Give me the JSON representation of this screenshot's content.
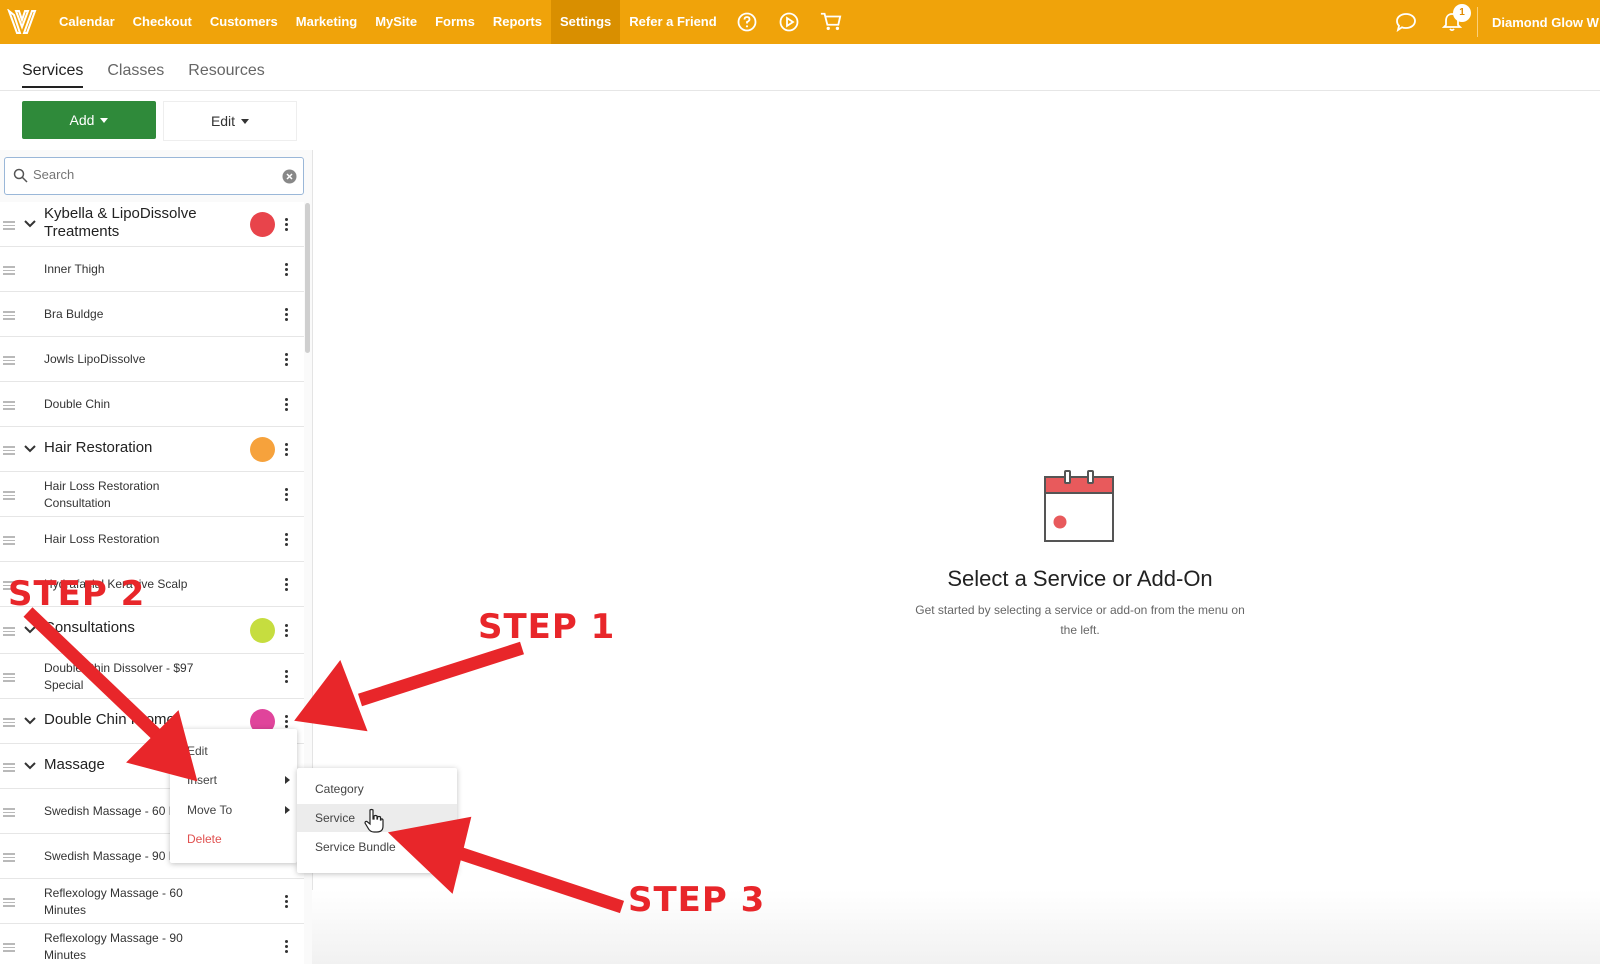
{
  "nav": {
    "items": [
      "Calendar",
      "Checkout",
      "Customers",
      "Marketing",
      "MySite",
      "Forms",
      "Reports",
      "Settings",
      "Refer a Friend"
    ],
    "active": "Settings",
    "notification_count": "1",
    "account_name": "Diamond Glow W"
  },
  "tabs": [
    "Services",
    "Classes",
    "Resources"
  ],
  "toolbar": {
    "add_label": "Add",
    "edit_label": "Edit"
  },
  "search": {
    "placeholder": "Search"
  },
  "service_list": [
    {
      "type": "category",
      "label": "Kybella & LipoDissolve Treatments",
      "color": "#e8444b"
    },
    {
      "type": "item",
      "label": "Inner Thigh"
    },
    {
      "type": "item",
      "label": "Bra Buldge"
    },
    {
      "type": "item",
      "label": "Jowls LipoDissolve"
    },
    {
      "type": "item",
      "label": "Double Chin"
    },
    {
      "type": "category",
      "label": "Hair Restoration",
      "color": "#f6a23c"
    },
    {
      "type": "item",
      "label": "Hair Loss Restoration Consultation"
    },
    {
      "type": "item",
      "label": "Hair Loss Restoration"
    },
    {
      "type": "item",
      "label": "Hydrafacial Keravive Scalp"
    },
    {
      "type": "category",
      "label": "Consultations",
      "color": "#c6dd3f"
    },
    {
      "type": "item",
      "label": "Double Chin Dissolver - $97 Special"
    },
    {
      "type": "category",
      "label": "Double Chin Promo",
      "color": "#e0449b"
    },
    {
      "type": "category",
      "label": "Massage"
    },
    {
      "type": "item",
      "label": "Swedish Massage - 60 Minutes"
    },
    {
      "type": "item",
      "label": "Swedish Massage - 90 Minutes"
    },
    {
      "type": "item",
      "label": "Reflexology Massage - 60 Minutes"
    },
    {
      "type": "item",
      "label": "Reflexology Massage - 90 Minutes"
    }
  ],
  "context_menu": {
    "items": [
      "Edit",
      "Insert",
      "Move To",
      "Delete"
    ],
    "submenu": [
      "Category",
      "Service",
      "Service Bundle"
    ],
    "hovered_submenu_item": "Service"
  },
  "empty_state": {
    "title": "Select a Service or Add-On",
    "description": "Get started by selecting a service or add-on from the menu on the left."
  },
  "annotations": {
    "step1": "STEP 1",
    "step2": "STEP 2",
    "step3": "STEP 3",
    "color": "#e8262a"
  },
  "colors": {
    "brand": "#f0a30a",
    "add_button": "#2f8a3a"
  }
}
